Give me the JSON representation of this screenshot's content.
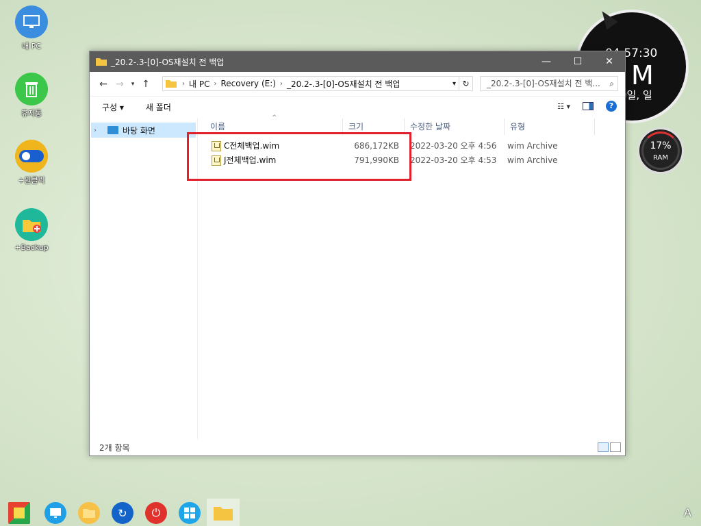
{
  "desktop": {
    "icons": [
      {
        "label": "내 PC",
        "icon": "monitor-icon"
      },
      {
        "label": "휴지통",
        "icon": "trash-icon"
      },
      {
        "label": "+원클릭",
        "icon": "toggle-icon"
      },
      {
        "label": "+Backup",
        "icon": "folder-plus-icon"
      }
    ]
  },
  "clock": {
    "time": "04:57:30",
    "ampm": "M",
    "date": "0일, 일"
  },
  "ram": {
    "percent": "17%",
    "label": "RAM"
  },
  "window": {
    "title": "_20.2-.3-[0]-OS재설치 전 백업",
    "controls": {
      "minimize": "—",
      "maximize": "☐",
      "close": "✕"
    },
    "breadcrumb": [
      "내 PC",
      "Recovery (E:)",
      "_20.2-.3-[0]-OS재설치 전 백업"
    ],
    "search_placeholder": "_20.2-.3-[0]-OS재설치 전 백...",
    "toolbar": {
      "organize": "구성 ▾",
      "new_folder": "새 폴더"
    },
    "nav_pane": {
      "item": "바탕 화면"
    },
    "columns": {
      "name": "이름",
      "size": "크기",
      "modified": "수정한 날짜",
      "type": "유형"
    },
    "files": [
      {
        "name": "C전체백업.wim",
        "size": "686,172KB",
        "modified": "2022-03-20 오후 4:56",
        "type": "wim Archive"
      },
      {
        "name": "J전체백업.wim",
        "size": "791,990KB",
        "modified": "2022-03-20 오후 4:53",
        "type": "wim Archive"
      }
    ],
    "status": "2개 항목"
  },
  "taskbar": {
    "icons": [
      "start-icon",
      "monitor-icon",
      "folder-icon",
      "refresh-icon",
      "power-icon",
      "windows-icon",
      "explorer-icon"
    ],
    "corner": "A"
  },
  "colors": {
    "highlight": "#e0202c",
    "titlebar": "#5b5b5b",
    "selection": "#cce8ff"
  }
}
